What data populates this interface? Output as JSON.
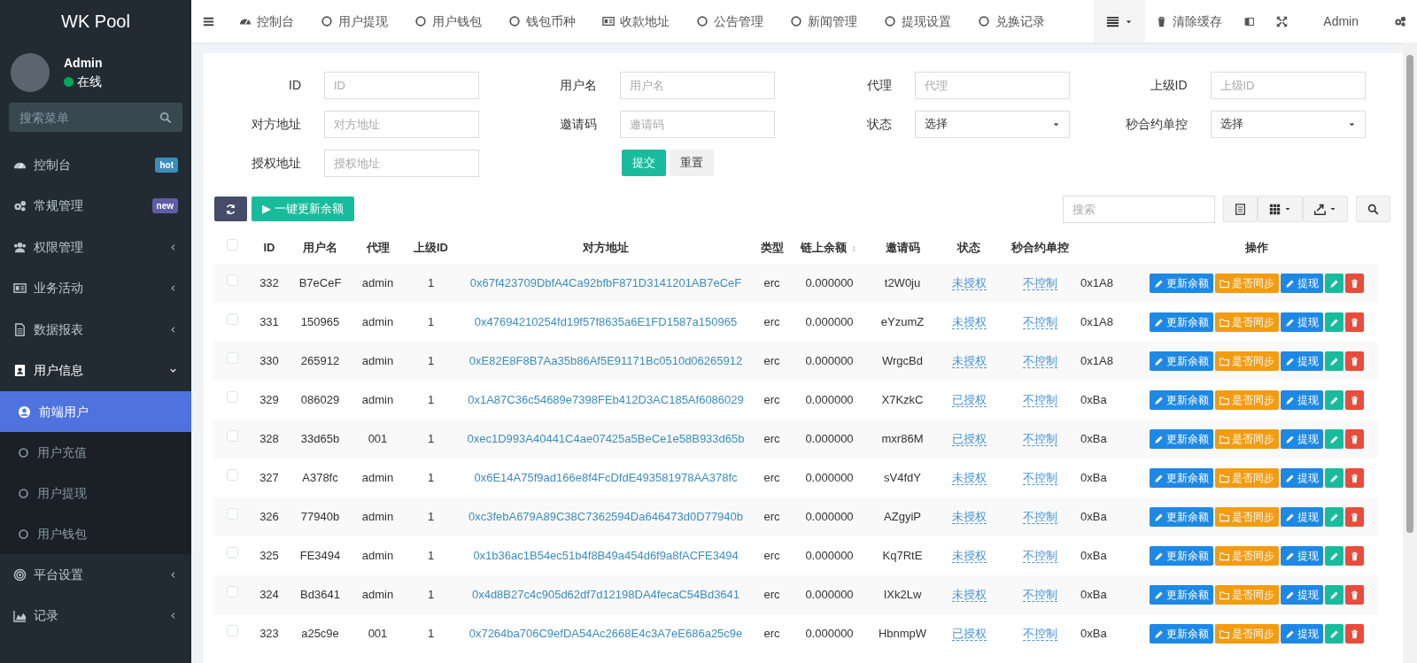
{
  "sidebar": {
    "brand": "WK Pool",
    "user": {
      "name": "Admin",
      "status": "在线",
      "online": true
    },
    "search": {
      "placeholder": "搜索菜单"
    },
    "items": [
      {
        "label": "控制台",
        "badge": "hot",
        "color": "#3c8dbc"
      },
      {
        "label": "常规管理",
        "badge": "new",
        "color": "#605ca8"
      },
      {
        "label": "权限管理",
        "expanded": false
      },
      {
        "label": "业务活动",
        "expanded": false
      },
      {
        "label": "数据报表",
        "expanded": false
      },
      {
        "label": "用户信息",
        "expanded": true,
        "children": [
          {
            "label": "前端用户",
            "selected": true
          },
          {
            "label": "用户充值",
            "selected": false
          },
          {
            "label": "用户提现",
            "selected": false
          },
          {
            "label": "用户钱包",
            "selected": false
          }
        ]
      },
      {
        "label": "平台设置",
        "expanded": false
      },
      {
        "label": "记录",
        "expanded": false
      }
    ]
  },
  "top_nav": {
    "items": [
      "控制台",
      "用户提现",
      "用户钱包",
      "钱包币种",
      "收款地址",
      "公告管理",
      "新闻管理",
      "提现设置",
      "兑换记录"
    ],
    "clear_cache": "清除缓存",
    "user": "Admin"
  },
  "filters": [
    {
      "label": "ID",
      "kind": "text",
      "placeholder": "ID"
    },
    {
      "label": "用户名",
      "kind": "text",
      "placeholder": "用户名"
    },
    {
      "label": "代理",
      "kind": "text",
      "placeholder": "代理"
    },
    {
      "label": "上级ID",
      "kind": "text",
      "placeholder": "上级ID"
    },
    {
      "label": "对方地址",
      "kind": "text",
      "placeholder": "对方地址"
    },
    {
      "label": "邀请码",
      "kind": "text",
      "placeholder": "邀请码"
    },
    {
      "label": "状态",
      "kind": "select",
      "value": "选择"
    },
    {
      "label": "秒合约单控",
      "kind": "select",
      "value": "选择"
    },
    {
      "label": "授权地址",
      "kind": "text",
      "placeholder": "授权地址"
    }
  ],
  "form_buttons": {
    "submit": "提交",
    "reset": "重置"
  },
  "toolbar": {
    "update_all": "▶ 一键更新余额",
    "search": {
      "placeholder": "搜索"
    }
  },
  "table": {
    "columns": [
      {
        "label": "ID",
        "sortable": false
      },
      {
        "label": "用户名",
        "sortable": false
      },
      {
        "label": "代理",
        "sortable": false
      },
      {
        "label": "上级ID",
        "sortable": false
      },
      {
        "label": "对方地址",
        "sortable": false
      },
      {
        "label": "类型",
        "sortable": false
      },
      {
        "label": "链上余额",
        "sortable": true
      },
      {
        "label": "邀请码",
        "sortable": false
      },
      {
        "label": "状态",
        "sortable": false
      },
      {
        "label": "秒合约单控",
        "sortable": false
      },
      {
        "label": "操作",
        "sortable": false
      }
    ],
    "select_all": false,
    "rows": [
      {
        "selected": false,
        "id": "332",
        "username": "B7eCeF",
        "agent": "admin",
        "parent_id": "1",
        "address": "0x67f423709DbfA4Ca92bfbF871D3141201AB7eCeF",
        "type": "erc",
        "balance": "0.000000",
        "invite_code": "t2W0ju",
        "status": "未授权",
        "control": "不控制",
        "column_11": "0x1A8",
        "actions": [
          "更新余额",
          "是否同步",
          "提现"
        ]
      },
      {
        "selected": false,
        "id": "331",
        "username": "150965",
        "agent": "admin",
        "parent_id": "1",
        "address": "0x47694210254fd19f57f8635a6E1FD1587a150965",
        "type": "erc",
        "balance": "0.000000",
        "invite_code": "eYzumZ",
        "status": "未授权",
        "control": "不控制",
        "column_11": "0x1A8",
        "actions": [
          "更新余额",
          "是否同步",
          "提现"
        ]
      },
      {
        "selected": false,
        "id": "330",
        "username": "265912",
        "agent": "admin",
        "parent_id": "1",
        "address": "0xE82E8F8B7Aa35b86Af5E91171Bc0510d06265912",
        "type": "erc",
        "balance": "0.000000",
        "invite_code": "WrgcBd",
        "status": "未授权",
        "control": "不控制",
        "column_11": "0x1A8",
        "actions": [
          "更新余额",
          "是否同步",
          "提现"
        ]
      },
      {
        "selected": false,
        "id": "329",
        "username": "086029",
        "agent": "admin",
        "parent_id": "1",
        "address": "0x1A87C36c54689e7398FEb412D3AC185Af6086029",
        "type": "erc",
        "balance": "0.000000",
        "invite_code": "X7KzkC",
        "status": "已授权",
        "control": "不控制",
        "column_11": "0xBa",
        "actions": [
          "更新余额",
          "是否同步",
          "提现"
        ]
      },
      {
        "selected": false,
        "id": "328",
        "username": "33d65b",
        "agent": "001",
        "parent_id": "1",
        "address": "0xec1D993A40441C4ae07425a5BeCe1e58B933d65b",
        "type": "erc",
        "balance": "0.000000",
        "invite_code": "mxr86M",
        "status": "已授权",
        "control": "不控制",
        "column_11": "0xBa",
        "actions": [
          "更新余额",
          "是否同步",
          "提现"
        ]
      },
      {
        "selected": false,
        "id": "327",
        "username": "A378fc",
        "agent": "admin",
        "parent_id": "1",
        "address": "0x6E14A75f9ad166e8f4FcDfdE493581978AA378fc",
        "type": "erc",
        "balance": "0.000000",
        "invite_code": "sV4fdY",
        "status": "未授权",
        "control": "不控制",
        "column_11": "0xBa",
        "actions": [
          "更新余额",
          "是否同步",
          "提现"
        ]
      },
      {
        "selected": false,
        "id": "326",
        "username": "77940b",
        "agent": "admin",
        "parent_id": "1",
        "address": "0xc3febA679A89C38C7362594Da646473d0D77940b",
        "type": "erc",
        "balance": "0.000000",
        "invite_code": "AZgyiP",
        "status": "未授权",
        "control": "不控制",
        "column_11": "0xBa",
        "actions": [
          "更新余额",
          "是否同步",
          "提现"
        ]
      },
      {
        "selected": false,
        "id": "325",
        "username": "FE3494",
        "agent": "admin",
        "parent_id": "1",
        "address": "0x1b36ac1B54ec51b4f8B49a454d6f9a8fACFE3494",
        "type": "erc",
        "balance": "0.000000",
        "invite_code": "Kq7RtE",
        "status": "未授权",
        "control": "不控制",
        "column_11": "0xBa",
        "actions": [
          "更新余额",
          "是否同步",
          "提现"
        ]
      },
      {
        "selected": false,
        "id": "324",
        "username": "Bd3641",
        "agent": "admin",
        "parent_id": "1",
        "address": "0x4d8B27c4c905d62df7d12198DA4fecaC54Bd3641",
        "type": "erc",
        "balance": "0.000000",
        "invite_code": "IXk2Lw",
        "status": "未授权",
        "control": "不控制",
        "column_11": "0xBa",
        "actions": [
          "更新余额",
          "是否同步",
          "提现"
        ]
      },
      {
        "selected": false,
        "id": "323",
        "username": "a25c9e",
        "agent": "001",
        "parent_id": "1",
        "address": "0x7264ba706C9efDA54Ac2668E4c3A7eE686a25c9e",
        "type": "erc",
        "balance": "0.000000",
        "invite_code": "HbnmpW",
        "status": "已授权",
        "control": "不控制",
        "column_11": "0xBa",
        "actions": [
          "更新余额",
          "是否同步",
          "提现"
        ]
      }
    ]
  }
}
